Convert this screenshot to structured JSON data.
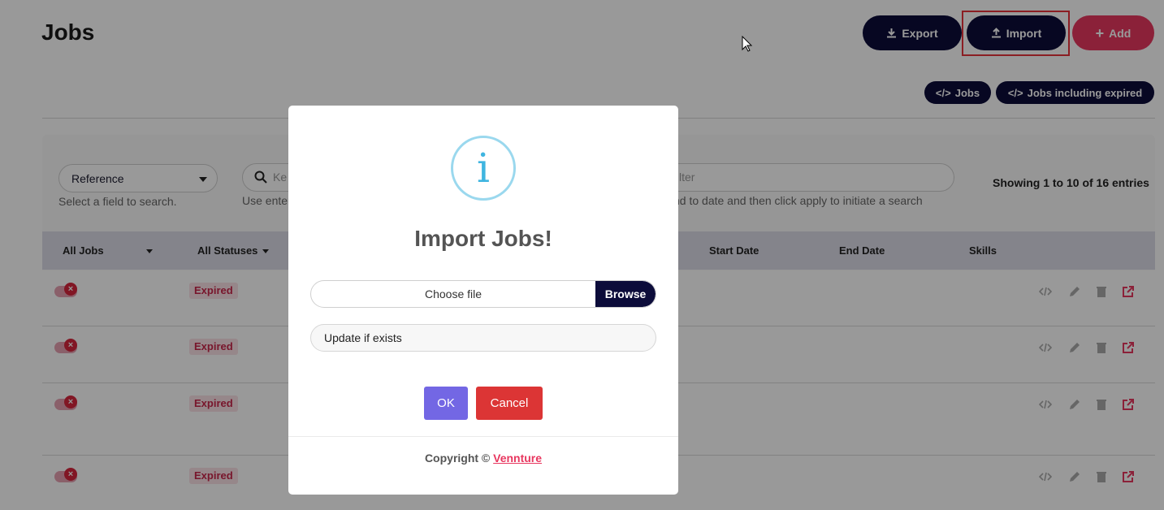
{
  "page": {
    "title": "Jobs",
    "buttons": {
      "export": "Export",
      "import": "Import",
      "add": "Add"
    },
    "pills": {
      "jobs": "Jobs",
      "jobs_expired": "Jobs including expired"
    }
  },
  "filters": {
    "field_select": "Reference",
    "field_hint": "Select a field to search.",
    "search_placeholder": "Ke",
    "search_hint": "Use enter",
    "date_placeholder": "lter",
    "date_hint": "nd to date and then click apply to initiate a search",
    "showing": "Showing 1 to 10 of 16 entries"
  },
  "table": {
    "headers": {
      "all_jobs": "All Jobs",
      "all_statuses": "All Statuses",
      "start_date": "Start Date",
      "end_date": "End Date",
      "skills": "Skills"
    },
    "rows": [
      {
        "status": "Expired"
      },
      {
        "status": "Expired"
      },
      {
        "status": "Expired"
      },
      {
        "status": "Expired"
      }
    ]
  },
  "modal": {
    "icon": "info-icon",
    "icon_glyph": "i",
    "title": "Import Jobs!",
    "file_label": "Choose file",
    "browse": "Browse",
    "update_option": "Update if exists",
    "ok": "OK",
    "cancel": "Cancel",
    "footer_prefix": "Copyright ©",
    "footer_link": "Vennture"
  },
  "colors": {
    "navy": "#0c0c3a",
    "accent": "#e8375f",
    "ok": "#7367e4",
    "cancel": "#dc3535",
    "info": "#3fb5e0"
  }
}
